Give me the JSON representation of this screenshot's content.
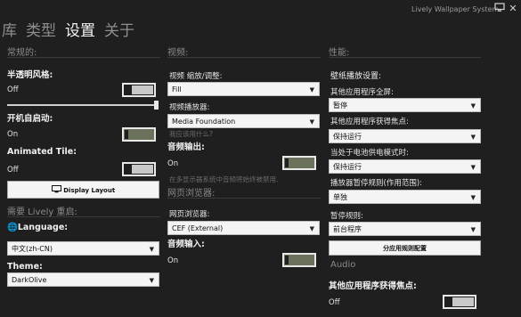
{
  "title_bar": {
    "tabs": [
      {
        "label": "库"
      },
      {
        "label": "类型"
      },
      {
        "label": "设置"
      },
      {
        "label": "关于"
      }
    ],
    "app_title": "Lively Wallpaper System",
    "monitor_icon": "monitor-icon",
    "close_icon": "close-icon"
  },
  "general": {
    "header": "常规的:",
    "transparency_label": "半透明风格:",
    "transparency_state": "Off",
    "transparency_level": 1.0,
    "startup_label": "开机自启动:",
    "startup_state": "On",
    "animated_tile_label": "Animated Tile:",
    "animated_tile_state": "Off",
    "display_layout_button": "Display Layout",
    "restart_header": "需要 Lively 重启:",
    "language_label": "Language:",
    "language_value": "中文(zh-CN)",
    "theme_label": "Theme:",
    "theme_value": "DarkOlive"
  },
  "video": {
    "header": "视频:",
    "scaling_label": "视频 缩放/调整:",
    "scaling_value": "Fill",
    "player_label": "视频播放器:",
    "player_value": "Media Foundation",
    "player_hint": "我应该用什么?",
    "audio_output_label": "音频输出:",
    "audio_output_state": "On",
    "audio_hint": "在多显示器系统中音频将始终被禁用.",
    "web_header": "网页浏览器:",
    "browser_label": "网页浏览器:",
    "browser_value": "CEF (External)",
    "audio_input_label": "音频输入:",
    "audio_input_state": "On"
  },
  "performance": {
    "header": "性能:",
    "playback_label": "壁纸播放设置:",
    "fullscreen_label": "其他应用程序全屏:",
    "fullscreen_value": "暂停",
    "focus_label": "其他应用程序获得焦点:",
    "focus_value": "保持运行",
    "battery_label": "当处于电池供电模式时:",
    "battery_value": "保持运行",
    "pause_rule_label": "播放器暂停规则(作用范围):",
    "pause_rule_value": "单独",
    "pause_label": "暂停规则:",
    "pause_value": "前台程序",
    "app_rules_button": "分应用规则配置",
    "audio_header": "Audio",
    "audio_focus_label": "其他应用程序获得焦点:",
    "audio_focus_state": "Off"
  },
  "colors": {
    "background": "#1f1f1f",
    "accent_on": "#6b725c"
  }
}
